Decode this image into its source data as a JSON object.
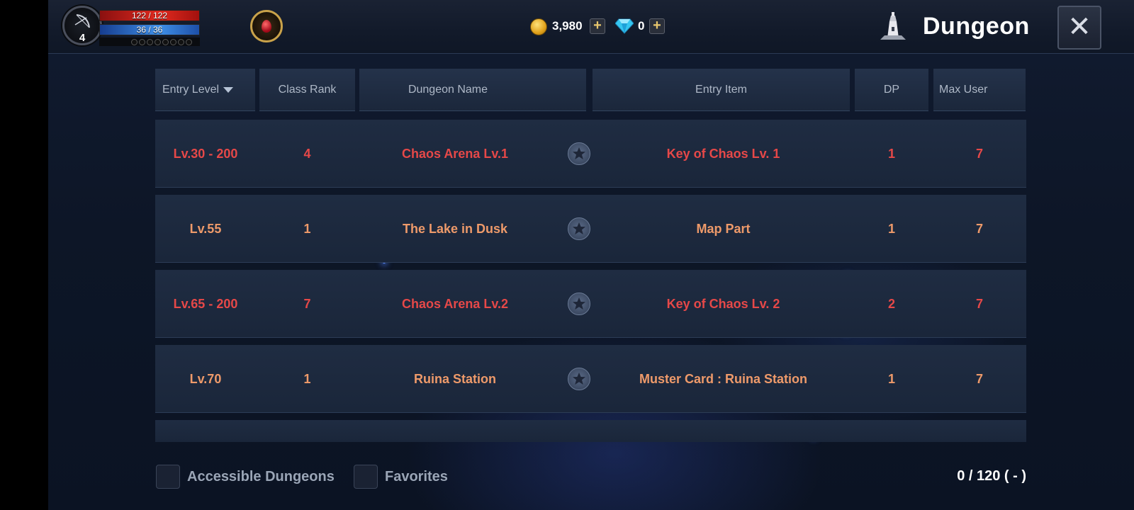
{
  "player": {
    "level": "4",
    "hp": "122 / 122",
    "mp": "36 / 36"
  },
  "currency": {
    "gold": "3,980",
    "gems": "0",
    "add_label": "+"
  },
  "header": {
    "title": "Dungeon",
    "close_label": "✕"
  },
  "table": {
    "columns": {
      "entry_level": "Entry Level",
      "class_rank": "Class Rank",
      "dungeon_name": "Dungeon Name",
      "entry_item": "Entry Item",
      "dp": "DP",
      "max_user": "Max User"
    },
    "rows": [
      {
        "entry_level": "Lv.30 - 200",
        "class_rank": "4",
        "dungeon_name": "Chaos Arena Lv.1",
        "entry_item": "Key of Chaos Lv. 1",
        "dp": "1",
        "max_user": "7",
        "color": "#e64848"
      },
      {
        "entry_level": "Lv.55",
        "class_rank": "1",
        "dungeon_name": "The Lake in Dusk",
        "entry_item": "Map Part",
        "dp": "1",
        "max_user": "7",
        "color": "#ee9a6a"
      },
      {
        "entry_level": "Lv.65 - 200",
        "class_rank": "7",
        "dungeon_name": "Chaos Arena Lv.2",
        "entry_item": "Key of Chaos Lv. 2",
        "dp": "2",
        "max_user": "7",
        "color": "#e64848"
      },
      {
        "entry_level": "Lv.70",
        "class_rank": "1",
        "dungeon_name": "Ruina Station",
        "entry_item": "Muster Card : Ruina Station",
        "dp": "1",
        "max_user": "7",
        "color": "#ee9a6a"
      }
    ]
  },
  "footer": {
    "accessible_label": "Accessible Dungeons",
    "favorites_label": "Favorites",
    "count": "0 / 120 ( - )"
  }
}
